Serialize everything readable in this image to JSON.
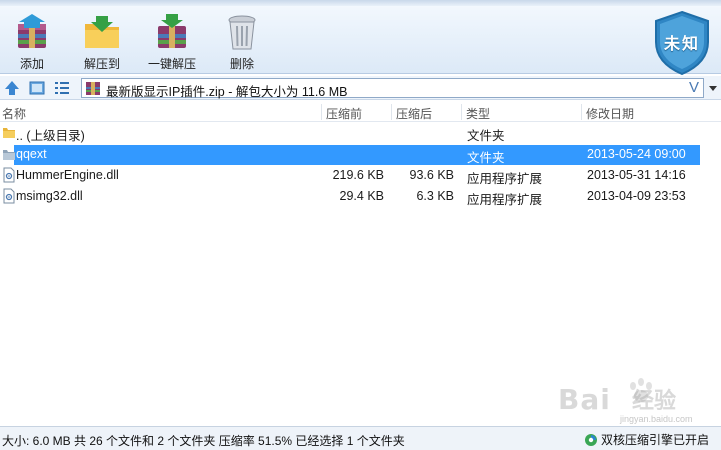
{
  "toolbar": {
    "buttons": [
      {
        "label": "添加"
      },
      {
        "label": "解压到"
      },
      {
        "label": "一键解压"
      },
      {
        "label": "删除"
      }
    ],
    "shield_text": "未知"
  },
  "address": {
    "text": "最新版显示IP插件.zip - 解包大小为 11.6 MB",
    "dropdown_glyph": "V"
  },
  "columns": {
    "name": "名称",
    "size": "压缩前",
    "packed": "压缩后",
    "type": "类型",
    "modified": "修改日期"
  },
  "rows": [
    {
      "name": ".. (上级目录)",
      "size": "",
      "packed": "",
      "type": "文件夹",
      "modified": "",
      "icon": "folder-icon"
    },
    {
      "name": "qqext",
      "size": "",
      "packed": "",
      "type": "文件夹",
      "modified": "2013-05-24 09:00",
      "icon": "folder-icon",
      "selected": true
    },
    {
      "name": "HummerEngine.dll",
      "size": "219.6 KB",
      "packed": "93.6 KB",
      "type": "应用程序扩展",
      "modified": "2013-05-31 14:16",
      "icon": "dll-file-icon"
    },
    {
      "name": "msimg32.dll",
      "size": "29.4 KB",
      "packed": "6.3 KB",
      "type": "应用程序扩展",
      "modified": "2013-04-09 23:53",
      "icon": "dll-file-icon"
    }
  ],
  "status": {
    "summary": "大小: 6.0 MB 共 26 个文件和 2 个文件夹 压缩率 51.5% 已经选择 1 个文件夹",
    "engine": "双核压缩引擎已开启"
  },
  "watermark": {
    "brand": "Bai",
    "brand_suffix": "经验",
    "url": "jingyan.baidu.com"
  },
  "colors": {
    "selection": "#3399ff",
    "shield": "#2f86c4",
    "toolbar_bg": "#e4eef9"
  }
}
